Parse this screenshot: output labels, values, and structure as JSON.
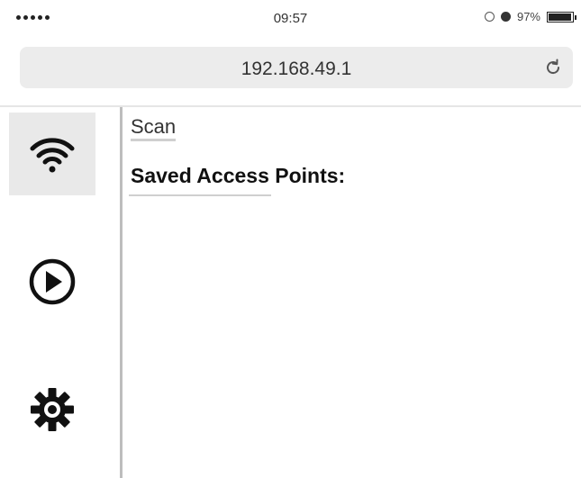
{
  "status_bar": {
    "signal_dots": 5,
    "time": "09:57",
    "battery_percent": "97%",
    "battery_level": 0.97,
    "icons": [
      "alarm-icon",
      "bluetooth-icon",
      "battery-icon"
    ]
  },
  "browser": {
    "url": "192.168.49.1",
    "reload_icon": "reload-icon"
  },
  "sidebar": {
    "items": [
      {
        "name": "wifi",
        "icon": "wifi-icon",
        "active": true
      },
      {
        "name": "play",
        "icon": "play-icon",
        "active": false
      },
      {
        "name": "settings",
        "icon": "gear-icon",
        "active": false
      }
    ]
  },
  "main": {
    "scan_label": "Scan",
    "saved_title": "Saved Access Points:"
  },
  "colors": {
    "url_bar_bg": "#ececec",
    "active_nav_bg": "#e9e9e9",
    "divider": "#bdbdbd",
    "text": "#111111"
  }
}
